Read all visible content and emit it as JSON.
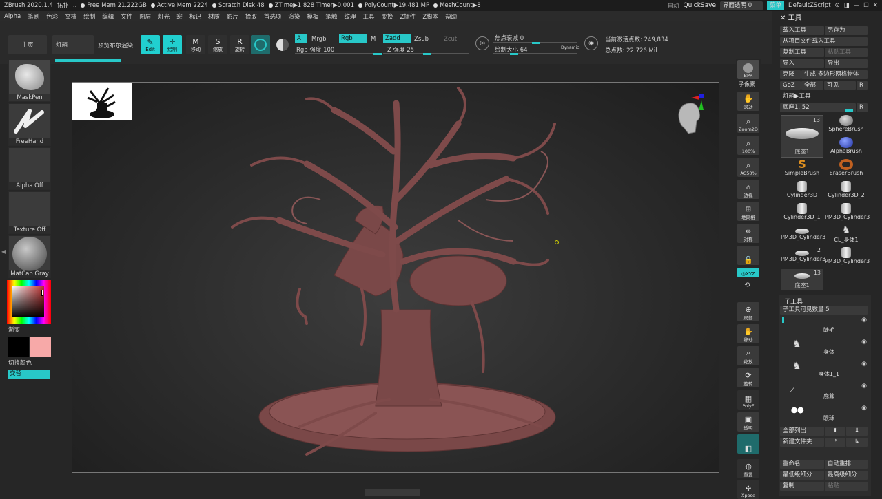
{
  "titlebar": {
    "app": "ZBrush 2020.1.4",
    "doc": "拓扑",
    "ellipsis": "..",
    "free_mem": "Free Mem 21.222GB",
    "active_mem": "Active Mem 2224",
    "scratch": "Scratch Disk 48",
    "ztime": "ZTime▶1.828 Timer▶0.001",
    "polycount": "PolyCount▶19.481 MP",
    "meshcount": "MeshCount▶8",
    "auto": "自动",
    "quicksave": "QuickSave",
    "interface_transparency": "界面透明 0",
    "menu": "菜单",
    "default_zscript": "DefaultZScript"
  },
  "menubar": [
    "Alpha",
    "笔刷",
    "色彩",
    "文档",
    "绘制",
    "编辑",
    "文件",
    "图层",
    "灯光",
    "宏",
    "标记",
    "材质",
    "影片",
    "拾取",
    "首选项",
    "渲染",
    "模板",
    "笔触",
    "纹理",
    "工具",
    "变换",
    "Z插件",
    "Z脚本",
    "帮助"
  ],
  "toolbar": {
    "home": "主页",
    "lightbox": "灯箱",
    "bpr_preview": "预览布尔渲染",
    "edit": "Edit",
    "draw": "绘制",
    "move": "移动",
    "scale": "缩放",
    "rotate": "旋转",
    "mrgb": "Mrgb",
    "a_label": "A",
    "rgb": "Rgb",
    "m": "M",
    "rgb_intensity": "Rgb 强度 100",
    "zadd": "Zadd",
    "zsub": "Zsub",
    "zcut": "Zcut",
    "z_intensity": "Z 强度 25",
    "focal_shift": "焦点衰减 0",
    "draw_size": "绘制大小 64",
    "dynamic": "Dynamic",
    "active_points": "当前激活点数: 249,834",
    "total_points": "总点数: 22.726 Mil"
  },
  "leftshelf": {
    "maskpen": "MaskPen",
    "freehand": "FreeHand",
    "alpha_off": "Alpha Off",
    "texture_off": "Texture Off",
    "matcap": "MatCap Gray",
    "gradient": "渐变",
    "switch_color": "切换颜色",
    "alternate": "交替",
    "colors": {
      "main": "#000000",
      "secondary": "#f7a9a8",
      "accent": "#28c8c8"
    }
  },
  "rightshelf": [
    "BPR",
    "子像素",
    "滚动",
    "Zoom2D",
    "100%",
    "AC50%",
    "透视",
    "地网格",
    "对称",
    "",
    "",
    "",
    "局部",
    "移动",
    "缩放",
    "旋转",
    "PolyF",
    "透明",
    "",
    "重置",
    "Xpose"
  ],
  "tray": {
    "title": "工具",
    "load_tool": "载入工具",
    "save_as": "另存为",
    "load_from_project": "从项目文件载入工具",
    "copy_tool": "复制工具",
    "paste_tool": "粘贴工具",
    "import": "导入",
    "export": "导出",
    "clone": "克隆",
    "make_polymesh": "生成 多边形网格物体",
    "goz": "GoZ",
    "all": "全部",
    "visible": "可见",
    "r": "R",
    "lightbox_tool": "灯箱▶工具",
    "base_slider": "底座1. 52",
    "tools": [
      {
        "name": "底座1",
        "count": "13"
      },
      {
        "name": "SphereBrush"
      },
      {
        "name": "AlphaBrush"
      },
      {
        "name": "SimpleBrush"
      },
      {
        "name": "EraserBrush"
      },
      {
        "name": "Cylinder3D"
      },
      {
        "name": "Cylinder3D_2"
      },
      {
        "name": "Cylinder3D_1"
      },
      {
        "name": "PM3D_Cylinder3"
      },
      {
        "name": "PM3D_Cylinder3"
      },
      {
        "name": "CL_身体1"
      },
      {
        "name": "PM3D_Cylinder3",
        "count": "2"
      },
      {
        "name": "PM3D_Cylinder3"
      },
      {
        "name": "底座1",
        "count": "13"
      }
    ],
    "subtool_title": "子工具",
    "subtool_visible": "子工具可见数量 5",
    "subtools": [
      "睫毛",
      "身体",
      "身体1_1",
      "鹿茸",
      "眼球"
    ],
    "list_all": "全部列出",
    "new_folder": "新建文件夹",
    "rename": "重命名",
    "auto_reorder": "自动重排",
    "lowest_sub": "最低级细分",
    "highest_sub": "最高级细分",
    "copy": "复制",
    "paste": "粘贴"
  }
}
